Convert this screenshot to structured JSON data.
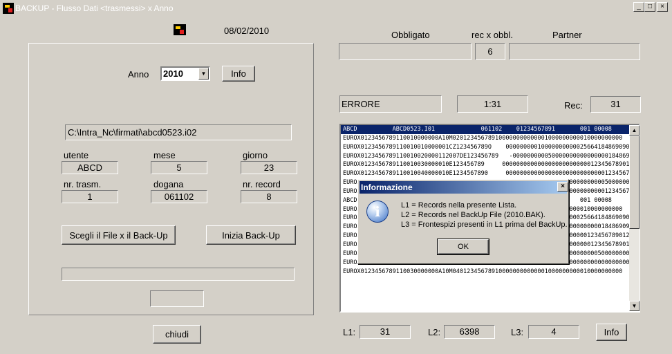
{
  "window": {
    "title": "BACKUP - Flusso Dati <trasmessi> x Anno",
    "minimize": "_",
    "maximize": "□",
    "close": "×"
  },
  "header": {
    "date": "08/02/2010"
  },
  "left": {
    "anno_label": "Anno",
    "anno_value": "2010",
    "info_button": "Info",
    "file_path": "C:\\Intra_Nc\\firmati\\abcd0523.i02",
    "fields": {
      "utente": {
        "label": "utente",
        "value": "ABCD"
      },
      "mese": {
        "label": "mese",
        "value": "5"
      },
      "giorno": {
        "label": "giorno",
        "value": "23"
      },
      "nr_trasm": {
        "label": "nr. trasm.",
        "value": "1"
      },
      "dogana": {
        "label": "dogana",
        "value": "061102"
      },
      "nr_record": {
        "label": "nr. record",
        "value": "8"
      }
    },
    "choose_file_button": "Scegli il File x il Back-Up",
    "start_backup_button": "Inizia Back-Up",
    "close_button": "chiudi"
  },
  "right": {
    "obbligato_label": "Obbligato",
    "rec_x_obbl_label": "rec x obbl.",
    "partner_label": "Partner",
    "rec_x_obbl_value": "6",
    "error_label": "ERRORE",
    "time_value": "1:31",
    "rec_label": "Rec:",
    "rec_value": "31",
    "list_rows": [
      "ABCD          ABCD0523.I01             061102    01234567891       001 00008",
      "EUROX0123456789110010000000A10M020123456789100000000000001000000000010000000000",
      "EUROX0123456789110010010000001CZ123456789O    000000000100000000000256641848690900000",
      "EUROX0123456789110010020000112007DE123456789   -0000000000500000000000000001848690909",
      "EUROX0123456789110010030000010E123456789     000000000000000000000000012345678901234",
      "EUROX0123456789110010040000010E1234567890     0000000000000000000000000000123456789012",
      "EUROX0123456789110010050000010E1234567890     00000000000000000000000000005000000000",
      "EUROX0123456789110010060000010E1234567890     000000000000000000000000000012345678901",
      "ABCD          ABCD0523.I02             061102    01234567891       001 00008",
      "EUROX0123456789110020000000A10M030123456789100000000000001000000000010000000000",
      "EUROX0123456789110020010000001CZ123456789O    00000000010000000000025664184869090000",
      "EUROX0123456789110020020000112007DE123456789  000000000050000000000000000184869090",
      "EUROX0123456789110020030000010E123456789     00000000000000000000000012345678901234",
      "EUROX012345678911002003000002DE123456789     0000000000100000000000000123456789012",
      "EUROX012345678911002004000013810009102345000002DE123456789    0000000000500000000000",
      "EUROX012345678911002004000021381000910234500001DE987654321    0000000000000000000000",
      "EUROX0123456789110030000000A10M040123456789100000000000001000000000010000000000"
    ],
    "l1_label": "L1:",
    "l1_value": "31",
    "l2_label": "L2:",
    "l2_value": "6398",
    "l3_label": "L3:",
    "l3_value": "4",
    "info_button": "Info"
  },
  "dialog": {
    "title": "Informazione",
    "close": "×",
    "line1": "L1 = Records nella presente Lista.",
    "line2": "L2 = Records nel BackUp File (2010.BAK).",
    "line3": "L3 = Frontespizi presenti in L1 prima del BackUp.",
    "ok_button": "OK"
  }
}
